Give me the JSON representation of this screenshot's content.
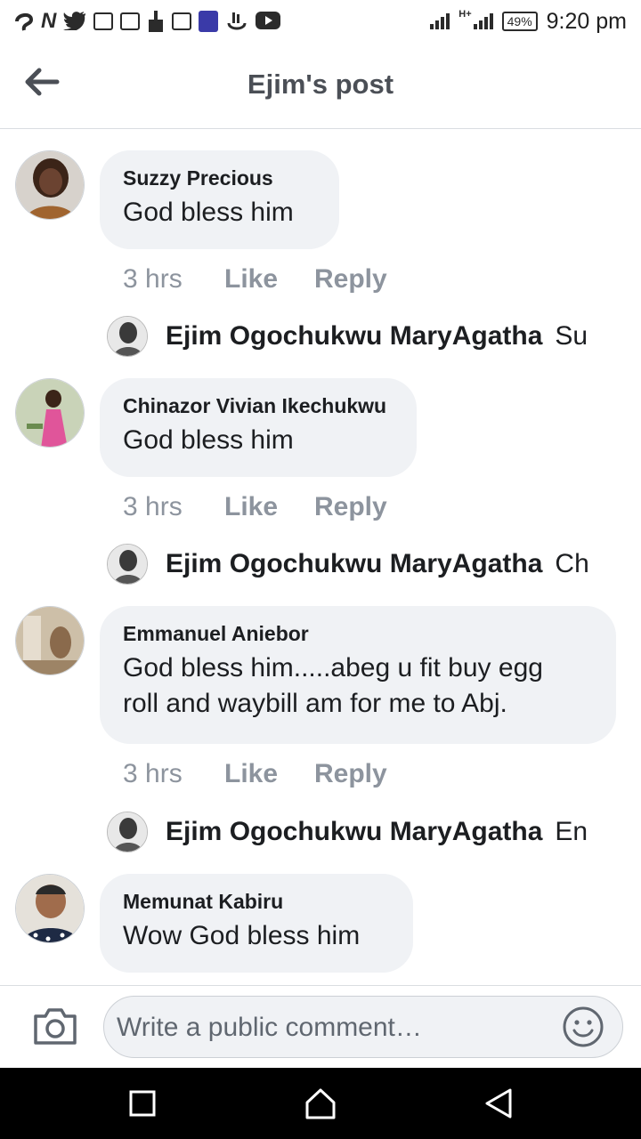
{
  "status_bar": {
    "time": "9:20 pm",
    "battery": "49%",
    "network": "H+",
    "left_icons": [
      "dji-icon",
      "n-icon",
      "twitter-icon",
      "gmail-icon",
      "gmail-icon",
      "cleaner-icon",
      "image-icon",
      "bible-icon",
      "hand-icon",
      "youtube-icon"
    ]
  },
  "header": {
    "title": "Ejim's post",
    "back_icon": "arrow-left-icon"
  },
  "comments": [
    {
      "author": "Suzzy Precious",
      "text": "God bless him",
      "time": "3 hrs",
      "like": "Like",
      "reply": "Reply",
      "reply_preview": {
        "name": "Ejim Ogochukwu MaryAgatha",
        "snippet": "Su"
      },
      "avatar_color": "#5a3b2e"
    },
    {
      "author": "Chinazor Vivian Ikechukwu",
      "text": "God bless him",
      "time": "3 hrs",
      "like": "Like",
      "reply": "Reply",
      "reply_preview": {
        "name": "Ejim Ogochukwu MaryAgatha",
        "snippet": "Ch"
      },
      "avatar_color": "#d24a8f"
    },
    {
      "author": "Emmanuel Aniebor",
      "text_line1": "God bless him.....abeg u fit buy egg",
      "text_line2": "roll and waybill am for me to Abj.",
      "time": "3 hrs",
      "like": "Like",
      "reply": "Reply",
      "reply_preview": {
        "name": "Ejim Ogochukwu MaryAgatha",
        "snippet": "En"
      },
      "avatar_color": "#b9a58c"
    },
    {
      "author": "Memunat Kabiru",
      "text": "Wow God bless him",
      "avatar_color": "#2f3b55"
    }
  ],
  "composer": {
    "placeholder": "Write a public comment…",
    "camera_icon": "camera-icon",
    "emoji_icon": "emoji-icon"
  },
  "nav": {
    "recents_icon": "square-icon",
    "home_icon": "home-icon",
    "back_icon": "triangle-back-icon"
  }
}
